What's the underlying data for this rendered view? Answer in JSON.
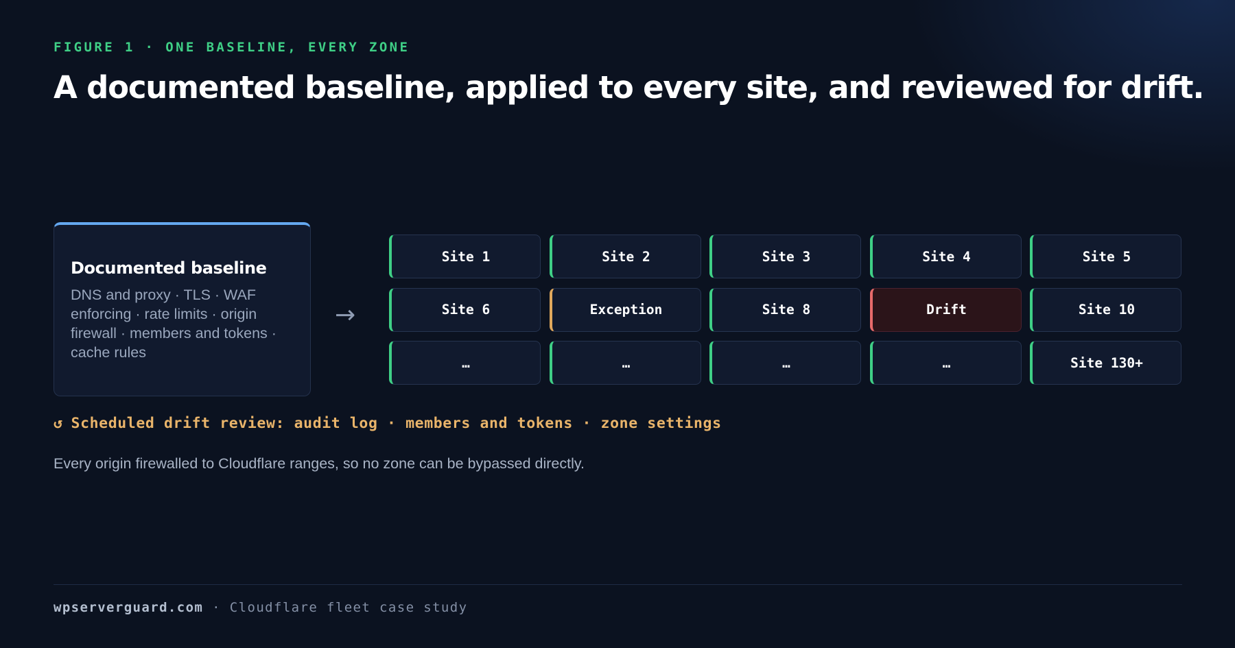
{
  "figure": {
    "eyebrow": "FIGURE 1 · ONE BASELINE, EVERY ZONE",
    "title": "A documented baseline, applied to every site, and reviewed for drift."
  },
  "baseline": {
    "title": "Documented baseline",
    "description": "DNS and proxy · TLS · WAF enforcing · rate limits · origin firewall · members and tokens · cache rules",
    "arrow": "→"
  },
  "sites": [
    {
      "label": "Site 1",
      "status": "ok"
    },
    {
      "label": "Site 2",
      "status": "ok"
    },
    {
      "label": "Site 3",
      "status": "ok"
    },
    {
      "label": "Site 4",
      "status": "ok"
    },
    {
      "label": "Site 5",
      "status": "ok"
    },
    {
      "label": "Site 6",
      "status": "ok"
    },
    {
      "label": "Exception",
      "status": "exception"
    },
    {
      "label": "Site 8",
      "status": "ok"
    },
    {
      "label": "Drift",
      "status": "drift"
    },
    {
      "label": "Site 10",
      "status": "ok"
    },
    {
      "label": "…",
      "status": "ok"
    },
    {
      "label": "…",
      "status": "ok"
    },
    {
      "label": "…",
      "status": "ok"
    },
    {
      "label": "…",
      "status": "ok"
    },
    {
      "label": "Site 130+",
      "status": "ok"
    }
  ],
  "review": {
    "icon": "↺",
    "text": "Scheduled drift review: audit log · members and tokens · zone settings"
  },
  "note": "Every origin firewalled to Cloudflare ranges, so no zone can be bypassed directly.",
  "footer": {
    "domain": "wpserverguard.com",
    "separator": " · ",
    "caption": "Cloudflare fleet case study"
  },
  "colors": {
    "background": "#0b1220",
    "accent_green": "#3fcf86",
    "accent_blue": "#64a8f0",
    "exception_amber": "#e0a85c",
    "drift_red": "#e66a6a",
    "review_amber": "#e9b46a"
  }
}
